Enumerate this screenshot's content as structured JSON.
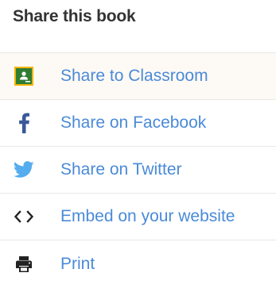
{
  "header": {
    "title": "Share this book"
  },
  "colors": {
    "link": "#4a8ad8",
    "classroom_green": "#2e7d32",
    "classroom_border": "#f4b400",
    "facebook": "#3b5998",
    "twitter": "#55acee",
    "icon_dark": "#222222"
  },
  "menu": {
    "items": [
      {
        "label": "Share to Classroom",
        "icon": "google-classroom-icon"
      },
      {
        "label": "Share on Facebook",
        "icon": "facebook-icon"
      },
      {
        "label": "Share on Twitter",
        "icon": "twitter-icon"
      },
      {
        "label": "Embed on your website",
        "icon": "code-embed-icon"
      },
      {
        "label": "Print",
        "icon": "printer-icon"
      }
    ]
  }
}
